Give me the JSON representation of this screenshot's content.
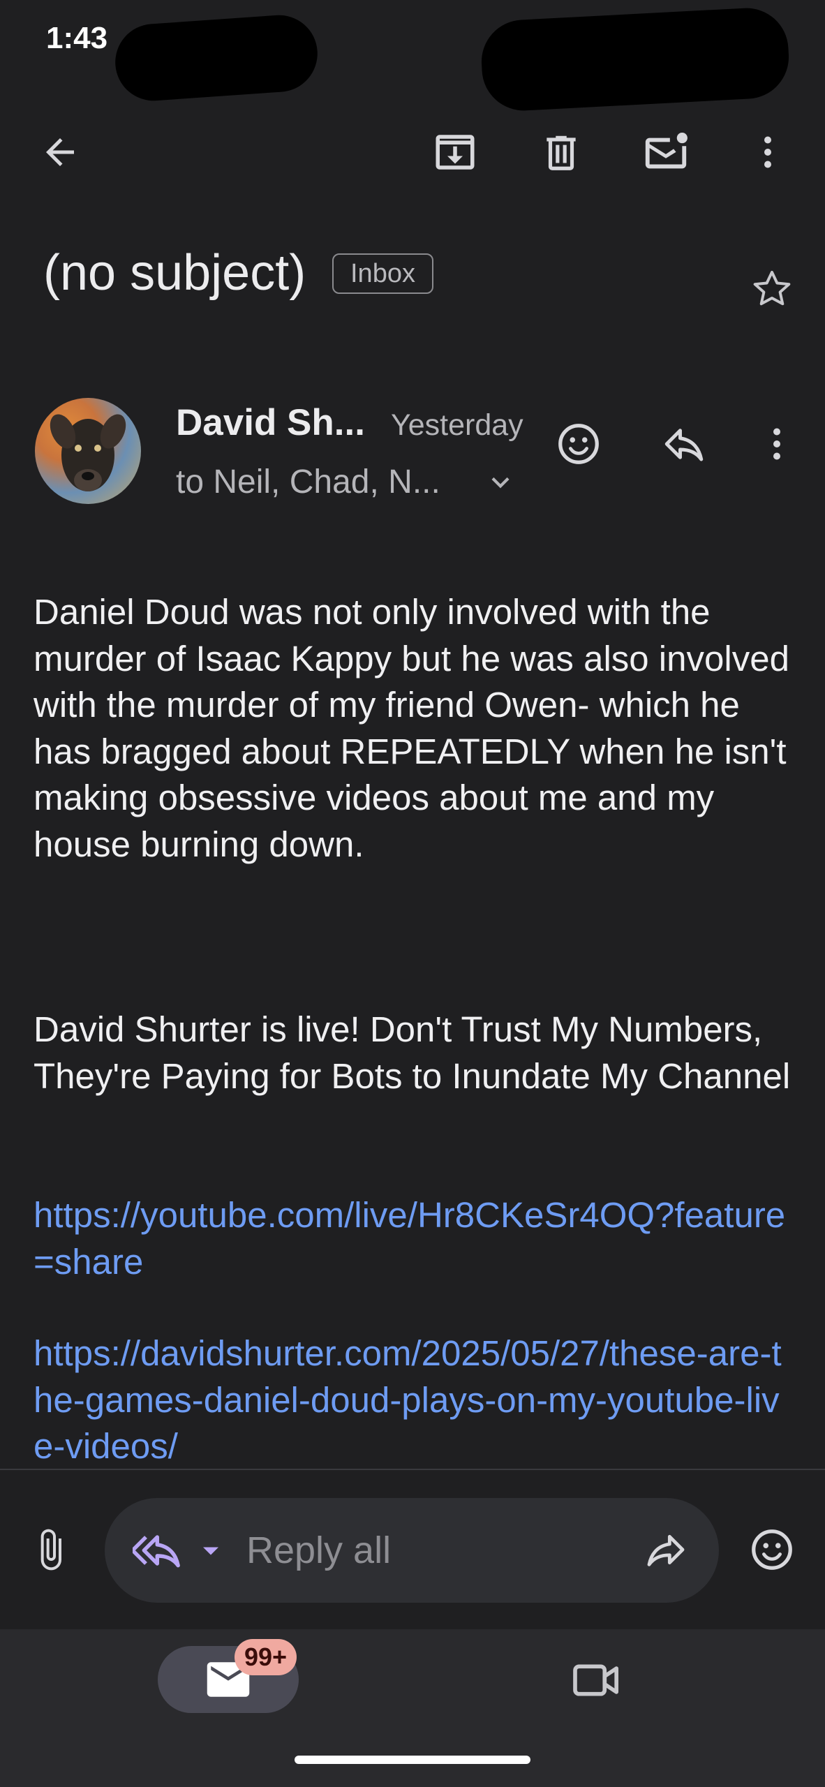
{
  "status_bar": {
    "time": "1:43"
  },
  "toolbar": {
    "back_icon": "arrow-left-icon",
    "archive_icon": "archive-icon",
    "delete_icon": "trash-icon",
    "mark_unread_icon": "mark-unread-icon",
    "more_icon": "more-vert-icon"
  },
  "email": {
    "subject": "(no subject)",
    "label": "Inbox",
    "sender": "David Sh...",
    "date": "Yesterday",
    "recipients": "to Neil, Chad, N...",
    "paragraphs": [
      "Daniel Doud was not only involved with the murder of Isaac Kappy but he was also involved with the murder of my friend Owen- which he has bragged about REPEATEDLY when he isn't making obsessive videos about me and my house burning down.",
      "David Shurter is live! Don't Trust My Numbers, They're Paying for Bots to Inundate My Channel"
    ],
    "links": [
      "https://youtube.com/live/Hr8CKeSr4OQ?feature=share",
      "https://davidshurter.com/2025/05/27/these-are-the-games-daniel-doud-plays-on-my-youtube-live-videos/"
    ]
  },
  "reply_bar": {
    "placeholder": "Reply all"
  },
  "bottom_nav": {
    "mail_badge": "99+"
  },
  "colors": {
    "background": "#1f1f21",
    "link": "#6e9cf3",
    "badge": "#f0a9a0",
    "reply_accent": "#b9a6f5"
  }
}
